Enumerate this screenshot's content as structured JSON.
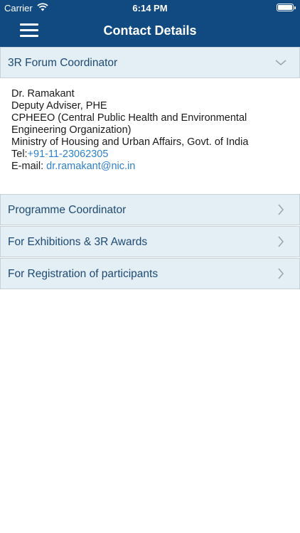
{
  "status_bar": {
    "carrier": "Carrier",
    "time": "6:14 PM"
  },
  "header": {
    "title": "Contact Details"
  },
  "sections": [
    {
      "label": "3R Forum Coordinator",
      "expanded": true
    },
    {
      "label": "Programme Coordinator",
      "expanded": false
    },
    {
      "label": "For Exhibitions & 3R Awards",
      "expanded": false
    },
    {
      "label": "For Registration of participants",
      "expanded": false
    }
  ],
  "contact": {
    "name": "Dr. Ramakant",
    "designation": "Deputy Adviser, PHE",
    "org_line1": "CPHEEO (Central Public Health and Environmental",
    "org_line2": "Engineering Organization)",
    "ministry": "Ministry of Housing and Urban Affairs, Govt. of India",
    "tel_label": "Tel:",
    "tel_value": "+91-11-23062305",
    "email_label": "E-mail: ",
    "email_value": "dr.ramakant@nic.in"
  },
  "colors": {
    "header_bg": "#104a80",
    "section_bg": "#e4eef5",
    "section_text": "#1d4a73",
    "link": "#2e80cf"
  },
  "icons": {
    "menu": "hamburger-menu-icon",
    "expanded": "chevron-down-icon",
    "collapsed": "chevron-right-icon"
  }
}
